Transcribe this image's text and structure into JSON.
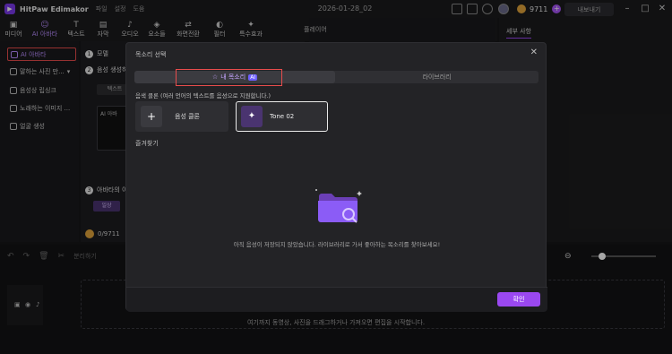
{
  "app": {
    "name": "HitPaw Edimakor",
    "menus": [
      "파일",
      "설정",
      "도움"
    ],
    "project_title": "2026-01-28_02",
    "credits": "9711",
    "export_label": "내보내기"
  },
  "toolbar": [
    {
      "label": "미디어",
      "icon": "media-icon"
    },
    {
      "label": "AI 아바타",
      "icon": "ai-avatar-icon"
    },
    {
      "label": "텍스트",
      "icon": "text-icon"
    },
    {
      "label": "자막",
      "icon": "subtitle-icon"
    },
    {
      "label": "오디오",
      "icon": "audio-icon"
    },
    {
      "label": "요소들",
      "icon": "elements-icon"
    },
    {
      "label": "화면전환",
      "icon": "transition-icon"
    },
    {
      "label": "필터",
      "icon": "filter-icon"
    },
    {
      "label": "특수효과",
      "icon": "effects-icon"
    }
  ],
  "left_panel": {
    "items": [
      "AI 아바타",
      "말하는 사진 만...",
      "음성상 립싱크",
      "노래하는 이미지 ...",
      "얼굴 생성"
    ]
  },
  "middle": {
    "step1": "모델",
    "step2": "음성 생성하기",
    "step3": "아바타의 이",
    "text_btn": "텍스트",
    "ai_btn": "AI 아바",
    "bottom_credits": "0/9711",
    "chip": "일상"
  },
  "preview": {
    "label": "플레이어"
  },
  "right_panel": {
    "tab": "세부 사항"
  },
  "modal": {
    "title": "목소리 선택",
    "tab_my": "내 목소리",
    "tab_ai": "AI",
    "tab_library": "라이브러리",
    "instruction": "음색 클론 (여러 언어의 텍스트를 음성으로 지원합니다.)",
    "clone_label": "음성 클론",
    "tone_label": "Tone 02",
    "favorites_label": "즐겨찾기",
    "empty_message": "아직 음성이 저장되지 않았습니다. 라이브러리로 가서 좋아하는 목소리를 찾아보세요!",
    "ok_label": "확인"
  },
  "timeline": {
    "split_label": "분리하기",
    "hint": "여기까지 동영상, 사진을 드래그하거나 가져오면 편집을 시작합니다."
  },
  "colors": {
    "accent": "#9a48f0",
    "highlight": "#e74c4c",
    "bg": "#161617"
  }
}
